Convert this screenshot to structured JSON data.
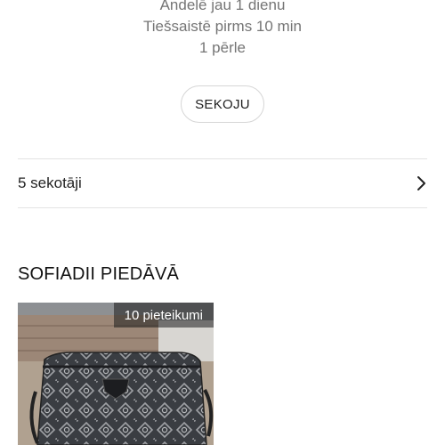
{
  "profile": {
    "info_lines": [
      "Andelē jau 1 dienu",
      "Tiešsaistē pirms 10 min",
      "1 pērle"
    ],
    "follow_button_label": "SEKOJU",
    "followers_label": "5 sekotāji"
  },
  "offers": {
    "section_title": "SOFIADII PIEDĀVĀ",
    "items": [
      {
        "badge": "10 pieteikumi",
        "image": "guess-monogram-crossbody-bag"
      }
    ]
  },
  "icons": {
    "followers_arrow": "chevron-right-icon"
  },
  "colors": {
    "text": "#222222",
    "muted": "#757575",
    "divider": "#e3e3e3"
  }
}
